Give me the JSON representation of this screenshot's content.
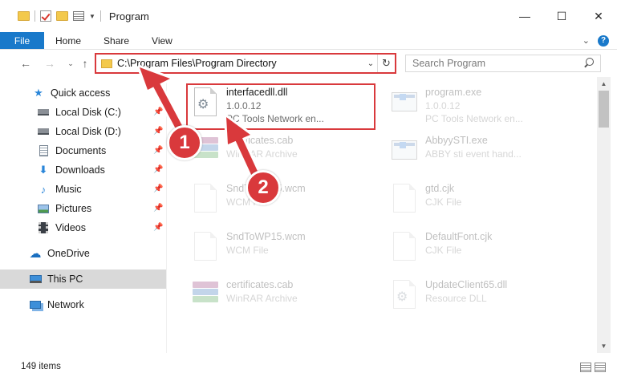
{
  "window": {
    "title": "Program"
  },
  "ribbon": {
    "tabs": [
      "File",
      "Home",
      "Share",
      "View"
    ]
  },
  "address": {
    "path": "C:\\Program Files\\Program Directory"
  },
  "search": {
    "placeholder": "Search Program"
  },
  "sidebar": {
    "items": [
      {
        "label": "Quick access",
        "icon": "star-icon"
      },
      {
        "label": "Local Disk (C:)",
        "icon": "drive-icon"
      },
      {
        "label": "Local Disk (D:)",
        "icon": "drive-icon"
      },
      {
        "label": "Documents",
        "icon": "documents-icon"
      },
      {
        "label": "Downloads",
        "icon": "download-icon"
      },
      {
        "label": "Music",
        "icon": "music-icon"
      },
      {
        "label": "Pictures",
        "icon": "pictures-icon"
      },
      {
        "label": "Videos",
        "icon": "videos-icon"
      },
      {
        "label": "OneDrive",
        "icon": "cloud-icon"
      },
      {
        "label": "This PC",
        "icon": "computer-icon"
      },
      {
        "label": "Network",
        "icon": "network-icon"
      }
    ]
  },
  "files": [
    {
      "name": "interfacedll.dll",
      "line2": "1.0.0.12",
      "line3": "PC Tools Network en...",
      "icon": "dll-icon"
    },
    {
      "name": "program.exe",
      "line2": "1.0.0.12",
      "line3": "PC Tools Network en...",
      "icon": "exe-icon"
    },
    {
      "name": "certificates.cab",
      "line2": "WinRAR Archive",
      "line3": "",
      "icon": "archive-icon"
    },
    {
      "name": "AbbyySTI.exe",
      "line2": "ABBY sti event hand...",
      "line3": "",
      "icon": "exe-icon"
    },
    {
      "name": "SndToWP15.wcm",
      "line2": "WCM File",
      "line3": "",
      "icon": "file-icon"
    },
    {
      "name": "gtd.cjk",
      "line2": "CJK File",
      "line3": "",
      "icon": "file-icon"
    },
    {
      "name": "SndToWP15.wcm",
      "line2": "WCM File",
      "line3": "",
      "icon": "file-icon"
    },
    {
      "name": "DefaultFont.cjk",
      "line2": "CJK File",
      "line3": "",
      "icon": "file-icon"
    },
    {
      "name": "certificates.cab",
      "line2": "WinRAR Archive",
      "line3": "",
      "icon": "archive-icon"
    },
    {
      "name": "UpdateClient65.dll",
      "line2": "Resource DLL",
      "line3": "",
      "icon": "dll-icon"
    }
  ],
  "status": {
    "count": "149 items"
  },
  "annotations": {
    "step1": "1",
    "step2": "2",
    "color": "#d9393c"
  },
  "colors": {
    "accent": "#1979ca",
    "highlight": "#d9393c",
    "selection": "#d9d9d9"
  }
}
